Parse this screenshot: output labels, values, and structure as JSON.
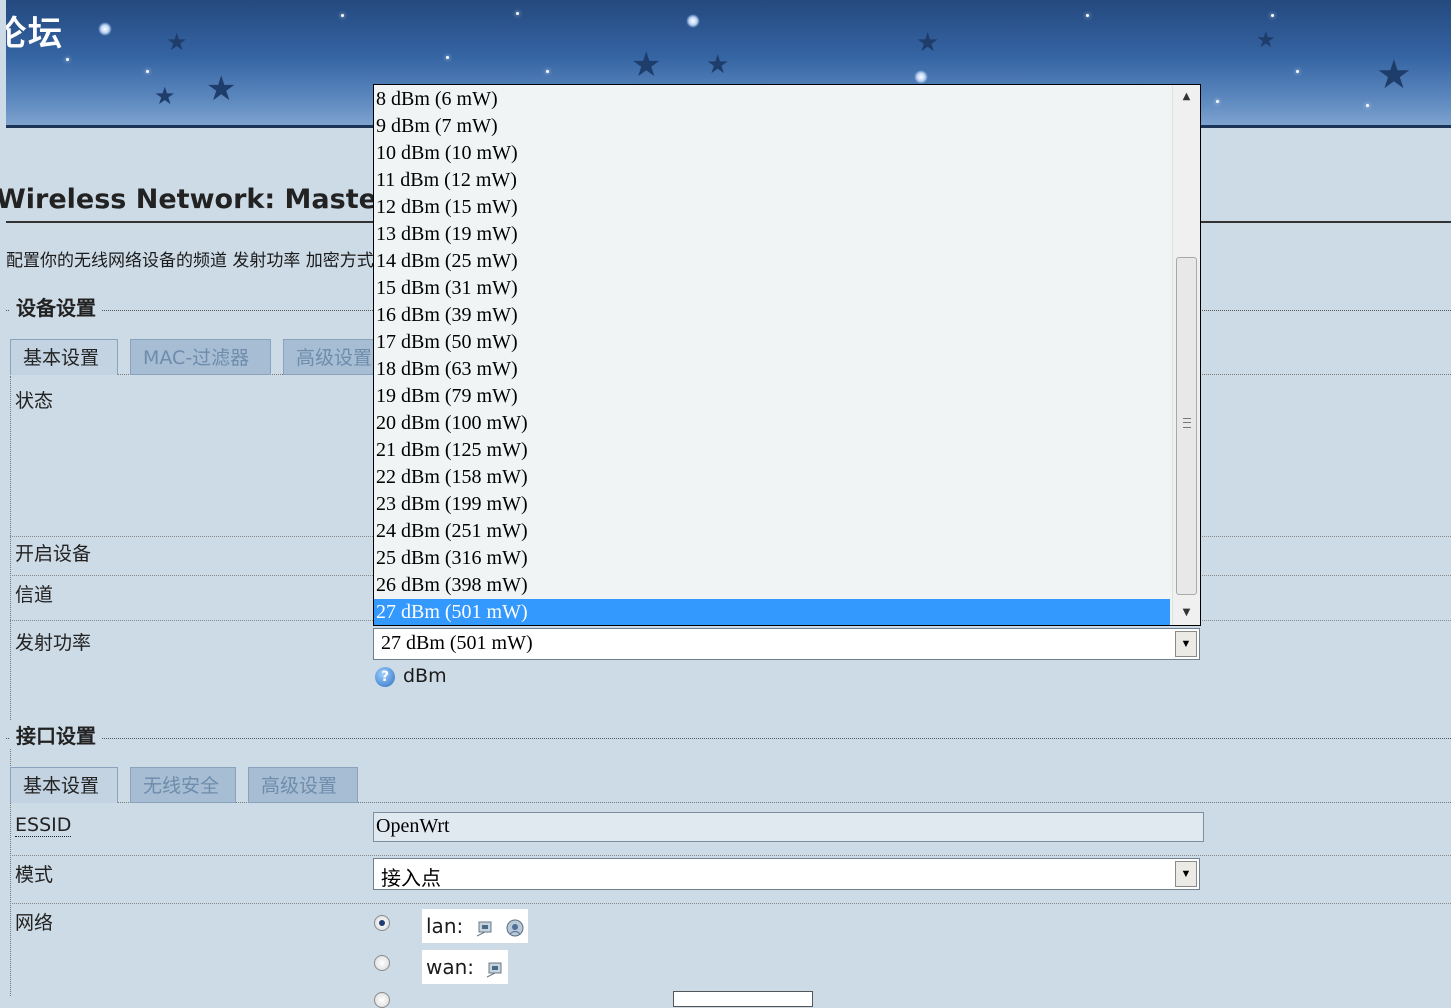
{
  "banner": {
    "title": "论坛"
  },
  "page": {
    "title": "Wireless Network: Master \"OpenWrt\"",
    "intro": "配置你的无线网络设备的频道 发射功率 加密方式 以及相关参数"
  },
  "device_section": {
    "legend": "设备设置",
    "tabs": [
      {
        "label": "基本设置"
      },
      {
        "label": "MAC-过滤器"
      },
      {
        "label": "高级设置"
      }
    ],
    "rows": {
      "status": "状态",
      "enable": "开启设备",
      "channel": "信道",
      "txpower": "发射功率"
    },
    "txpower_value": "27 dBm (501 mW)",
    "txpower_help": "dBm"
  },
  "txpower_dropdown": {
    "options": [
      "8 dBm (6 mW)",
      "9 dBm (7 mW)",
      "10 dBm (10 mW)",
      "11 dBm (12 mW)",
      "12 dBm (15 mW)",
      "13 dBm (19 mW)",
      "14 dBm (25 mW)",
      "15 dBm (31 mW)",
      "16 dBm (39 mW)",
      "17 dBm (50 mW)",
      "18 dBm (63 mW)",
      "19 dBm (79 mW)",
      "20 dBm (100 mW)",
      "21 dBm (125 mW)",
      "22 dBm (158 mW)",
      "23 dBm (199 mW)",
      "24 dBm (251 mW)",
      "25 dBm (316 mW)",
      "26 dBm (398 mW)",
      "27 dBm (501 mW)"
    ],
    "selected_index": 19
  },
  "interface_section": {
    "legend": "接口设置",
    "tabs": [
      {
        "label": "基本设置"
      },
      {
        "label": "无线安全"
      },
      {
        "label": "高级设置"
      }
    ],
    "rows": {
      "essid": "ESSID",
      "mode": "模式",
      "network": "网络"
    },
    "essid_value": "OpenWrt",
    "mode_value": "接入点",
    "networks": [
      {
        "label": "lan:"
      },
      {
        "label": "wan:"
      }
    ]
  }
}
